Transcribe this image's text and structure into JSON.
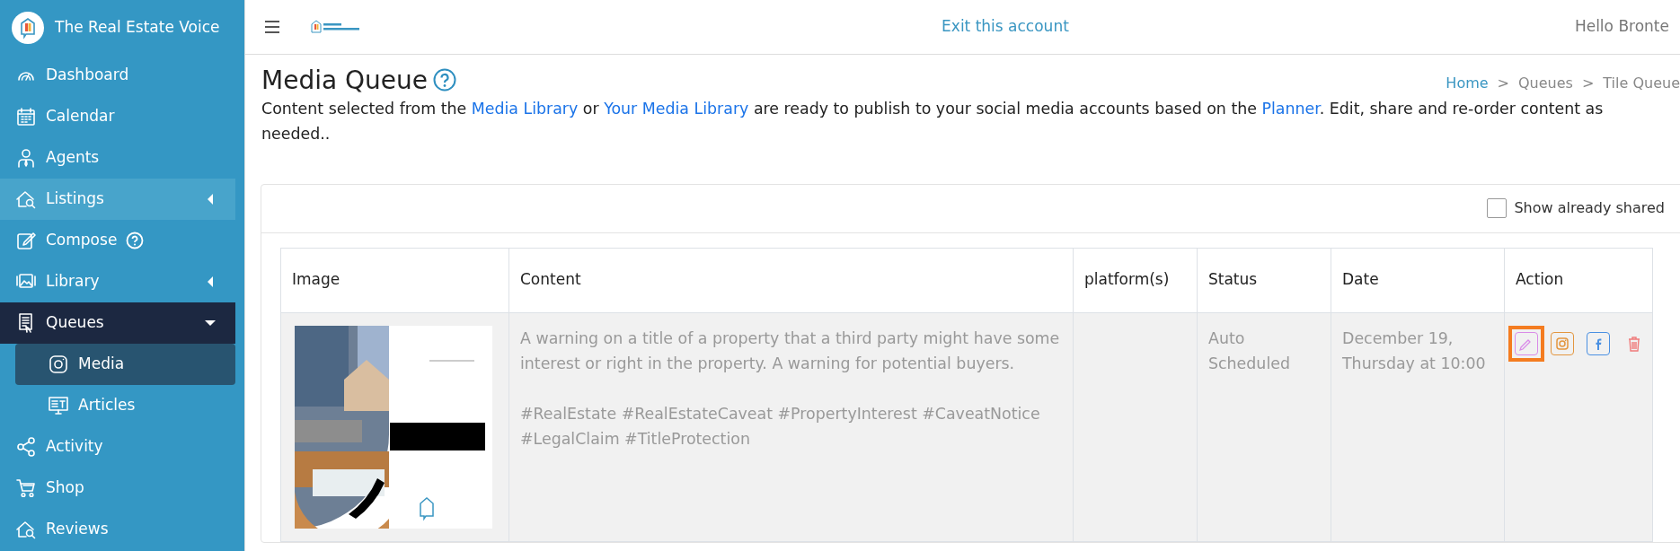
{
  "sidebar": {
    "brand": "The Real Estate Voice",
    "items": [
      {
        "label": "Dashboard",
        "kind": "gauge",
        "selected": false
      },
      {
        "label": "Calendar",
        "kind": "calendar",
        "selected": false
      },
      {
        "label": "Agents",
        "kind": "person",
        "selected": false
      },
      {
        "label": "Listings",
        "kind": "house-search",
        "selected": false,
        "hovered": true,
        "expanded": false
      },
      {
        "label": "Compose",
        "kind": "pencil",
        "selected": false,
        "help": true
      },
      {
        "label": "Library",
        "kind": "images",
        "selected": false,
        "expanded": false
      },
      {
        "label": "Queues",
        "kind": "document",
        "selected": true,
        "expanded": true,
        "children": [
          {
            "label": "Media",
            "kind": "instagram",
            "selected": true
          },
          {
            "label": "Articles",
            "kind": "monitor",
            "selected": false
          }
        ]
      },
      {
        "label": "Activity",
        "kind": "share",
        "selected": false
      },
      {
        "label": "Shop",
        "kind": "cart",
        "selected": false
      },
      {
        "label": "Reviews",
        "kind": "house-search",
        "selected": false
      }
    ]
  },
  "header": {
    "exit_link": "Exit this account",
    "greeting": "Hello Bronte"
  },
  "page": {
    "title": "Media Queue",
    "breadcrumb": [
      {
        "kind": "link",
        "text": "Home"
      },
      {
        "kind": "separator",
        "text": ">"
      },
      {
        "kind": "link",
        "text": "Queues"
      },
      {
        "kind": "separator",
        "text": ">"
      },
      {
        "kind": "current",
        "text": "Tile Queue"
      }
    ],
    "description": [
      {
        "kind": "text",
        "text": "Content selected from the "
      },
      {
        "kind": "link",
        "text": "Media Library"
      },
      {
        "kind": "text",
        "text": " or "
      },
      {
        "kind": "link",
        "text": "Your Media Library"
      },
      {
        "kind": "text",
        "text": " are ready to publish to your social media accounts based on the "
      },
      {
        "kind": "link",
        "text": "Planner"
      },
      {
        "kind": "text",
        "text": ". Edit, share and re-order content as needed.."
      }
    ]
  },
  "filter": {
    "label": "Show already shared",
    "checked": false
  },
  "table": {
    "columns": [
      "Image",
      "Content",
      "platform(s)",
      "Status",
      "Date",
      "Action"
    ],
    "rows": [
      {
        "image": {
          "kind": "picture"
        },
        "content": [
          "A warning on a title of a property that a third party might have some interest or right in the property. A warning for potential buyers.",
          "#RealEstate #RealEstateCaveat #PropertyInterest #CaveatNotice #LegalClaim #TitleProtection"
        ],
        "status": "Auto Scheduled",
        "date": "December 19, Thursday at 10:00",
        "actions": [
          {
            "kind": "edit",
            "focused": true
          },
          {
            "kind": "instagram",
            "focused": false
          },
          {
            "kind": "facebook",
            "focused": false
          },
          {
            "kind": "delete",
            "focused": false
          }
        ]
      }
    ]
  }
}
